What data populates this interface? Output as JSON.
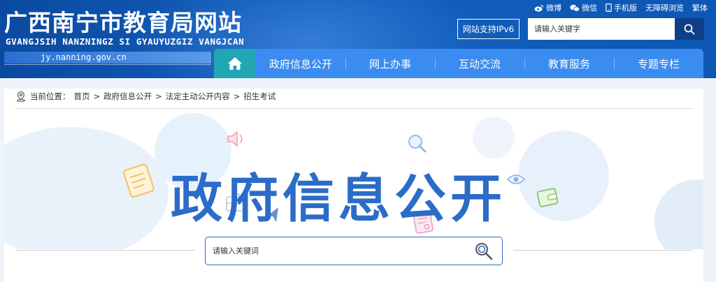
{
  "header": {
    "title": "广西南宁市教育局网站",
    "subtitle": "GVANGJSIH NANZNINGZ SI GYAUYUZGIZ VANGJCAN",
    "domain": "jy.nanning.gov.cn",
    "top_links": [
      {
        "icon": "weibo-icon",
        "label": "微博"
      },
      {
        "icon": "wechat-icon",
        "label": "微信"
      },
      {
        "icon": "mobile-icon",
        "label": "手机版"
      },
      {
        "icon": "",
        "label": "无障碍浏览"
      },
      {
        "icon": "",
        "label": "繁体"
      }
    ],
    "ipv6_label": "网站支持IPv6",
    "search_placeholder": "请输入关键字"
  },
  "nav": {
    "home_icon": "home-icon",
    "items": [
      "政府信息公开",
      "网上办事",
      "互动交流",
      "教育服务",
      "专题专栏"
    ]
  },
  "breadcrumb": {
    "prefix": "当前位置：",
    "items": [
      "首页",
      "政府信息公开",
      "法定主动公开内容",
      "招生考试"
    ]
  },
  "banner": {
    "title": "政府信息公开",
    "search_placeholder": "请输入关键词"
  },
  "colors": {
    "header_blue": "#0d57b4",
    "nav_blue": "#3b8cf1",
    "home_teal": "#21a7b3",
    "title_blue": "#2b6cc8"
  }
}
